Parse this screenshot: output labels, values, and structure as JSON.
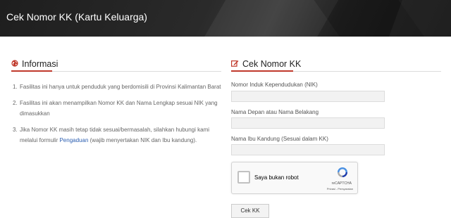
{
  "header": {
    "title": "Cek Nomor KK (Kartu Keluarga)"
  },
  "info": {
    "title": "Informasi",
    "icon": "globe-icon",
    "items": [
      {
        "num": "1.",
        "text": "Fasilitas ini hanya untuk penduduk yang berdomisili di Provinsi Kalimantan Barat"
      },
      {
        "num": "2.",
        "text": "Fasilitas ini akan menampilkan Nomor KK dan Nama Lengkap sesuai NIK yang dimasukkan"
      },
      {
        "num": "3.",
        "text_before": "Jika Nomor KK masih tetap tidak sesuai/bermasalah, silahkan hubungi kami melalui formulir ",
        "link": "Pengaduan",
        "text_after": " (wajib menyertakan NIK dan Ibu kandung)."
      }
    ]
  },
  "form": {
    "title": "Cek Nomor KK",
    "icon": "edit-icon",
    "fields": [
      {
        "label": "Nomor Induk Kependudukan (NIK)",
        "value": ""
      },
      {
        "label": "Nama Depan atau Nama Belakang",
        "value": ""
      },
      {
        "label": "Nama Ibu Kandung (Sesuai dalam KK)",
        "value": ""
      }
    ],
    "captcha": {
      "label": "Saya bukan robot",
      "brand": "reCAPTCHA",
      "links": "Privasi - Persyaratan"
    },
    "submit_label": "Cek KK"
  },
  "colors": {
    "accent": "#c0392b",
    "link": "#2a5db0",
    "banner": "#222222"
  }
}
